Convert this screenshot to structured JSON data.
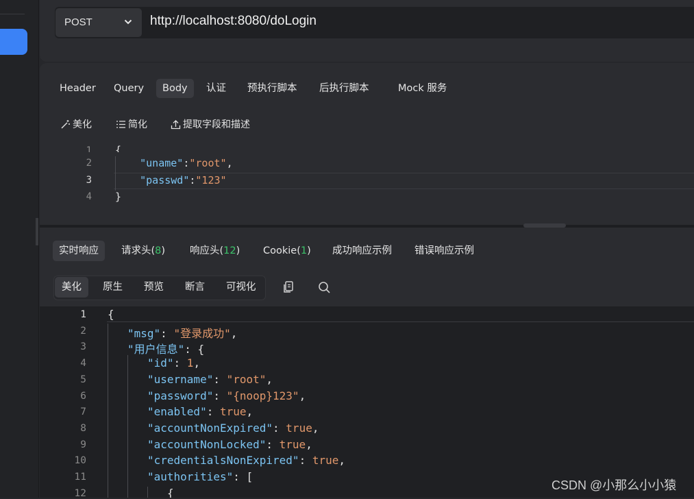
{
  "request": {
    "method": "POST",
    "url": "http://localhost:8080/doLogin",
    "tabs": [
      "Header",
      "Query",
      "Body",
      "认证",
      "预执行脚本",
      "后执行脚本",
      "Mock 服务"
    ],
    "active_tab": "Body",
    "tools": [
      "美化",
      "简化",
      "提取字段和描述"
    ],
    "body_line_numbers": [
      "1",
      "2",
      "3",
      "4"
    ],
    "body_lines": [
      {
        "key": "\"uname\"",
        "value": "\"root\"",
        "trail": ","
      },
      {
        "key": "\"passwd\"",
        "value": "\"123\"",
        "trail": ""
      }
    ],
    "brace_open": "{",
    "brace_close": "}"
  },
  "response": {
    "tabs": [
      {
        "label": "实时响应"
      },
      {
        "label": "请求头(",
        "count": "8",
        "close": ")"
      },
      {
        "label": "响应头(",
        "count": "12",
        "close": ")"
      },
      {
        "label": "Cookie(",
        "count": "1",
        "close": ")"
      },
      {
        "label": "成功响应示例"
      },
      {
        "label": "错误响应示例"
      }
    ],
    "active_tab": "实时响应",
    "view_modes": [
      "美化",
      "原生",
      "预览",
      "断言",
      "可视化"
    ],
    "active_view": "美化",
    "line_numbers": [
      "1",
      "2",
      "3",
      "4",
      "5",
      "6",
      "7",
      "8",
      "9",
      "10",
      "11",
      "12"
    ],
    "lines": [
      {
        "t": [
          [
            "p",
            "{"
          ]
        ]
      },
      {
        "t": [
          [
            "k",
            "\"msg\""
          ],
          [
            "p",
            ": "
          ],
          [
            "s",
            "\"登录成功\""
          ],
          [
            "p",
            ","
          ]
        ]
      },
      {
        "t": [
          [
            "k",
            "\"用户信息\""
          ],
          [
            "p",
            ": {"
          ]
        ]
      },
      {
        "t": [
          [
            "k",
            "\"id\""
          ],
          [
            "p",
            ": "
          ],
          [
            "b",
            "1"
          ],
          [
            "p",
            ","
          ]
        ]
      },
      {
        "t": [
          [
            "k",
            "\"username\""
          ],
          [
            "p",
            ": "
          ],
          [
            "s",
            "\"root\""
          ],
          [
            "p",
            ","
          ]
        ]
      },
      {
        "t": [
          [
            "k",
            "\"password\""
          ],
          [
            "p",
            ": "
          ],
          [
            "s",
            "\"{noop}123\""
          ],
          [
            "p",
            ","
          ]
        ]
      },
      {
        "t": [
          [
            "k",
            "\"enabled\""
          ],
          [
            "p",
            ": "
          ],
          [
            "b",
            "true"
          ],
          [
            "p",
            ","
          ]
        ]
      },
      {
        "t": [
          [
            "k",
            "\"accountNonExpired\""
          ],
          [
            "p",
            ": "
          ],
          [
            "b",
            "true"
          ],
          [
            "p",
            ","
          ]
        ]
      },
      {
        "t": [
          [
            "k",
            "\"accountNonLocked\""
          ],
          [
            "p",
            ": "
          ],
          [
            "b",
            "true"
          ],
          [
            "p",
            ","
          ]
        ]
      },
      {
        "t": [
          [
            "k",
            "\"credentialsNonExpired\""
          ],
          [
            "p",
            ": "
          ],
          [
            "b",
            "true"
          ],
          [
            "p",
            ","
          ]
        ]
      },
      {
        "t": [
          [
            "k",
            "\"authorities\""
          ],
          [
            "p",
            ": ["
          ]
        ]
      },
      {
        "t": [
          [
            "p",
            "{"
          ]
        ]
      }
    ]
  },
  "watermark": "CSDN @小那么小小猿"
}
